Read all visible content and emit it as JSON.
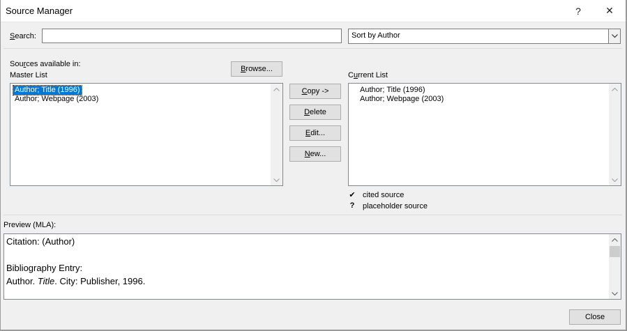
{
  "window": {
    "title": "Source Manager",
    "help_glyph": "?",
    "close_glyph": "✕"
  },
  "search": {
    "label_pre": "",
    "label_key": "S",
    "label_post": "earch:",
    "value": ""
  },
  "sort": {
    "selected": "Sort by Author"
  },
  "sources_available": {
    "label_pre": "Sou",
    "label_key": "r",
    "label_post": "ces available in:"
  },
  "master_list": {
    "label": "Master List",
    "items": [
      "Author; Title (1996)",
      "Author; Webpage (2003)"
    ],
    "selected_index": 0
  },
  "browse_button": {
    "key": "B",
    "rest": "rowse..."
  },
  "buttons": {
    "copy": {
      "key": "C",
      "rest": "opy ->"
    },
    "delete": {
      "key": "D",
      "rest": "elete"
    },
    "edit": {
      "key": "E",
      "rest": "dit..."
    },
    "new": {
      "key": "N",
      "rest": "ew..."
    }
  },
  "current_list": {
    "label_key": "u",
    "label_pre": "C",
    "label_post": "rrent List",
    "items": [
      "Author; Title (1996)",
      "Author; Webpage (2003)"
    ]
  },
  "legend": [
    {
      "symbol": "✔",
      "label": "cited source"
    },
    {
      "symbol": "?",
      "label": "placeholder source"
    }
  ],
  "preview": {
    "label": "Preview (MLA):",
    "citation": "Citation:  (Author)",
    "bibliography_heading": "Bibliography Entry:",
    "bib_author": "Author. ",
    "bib_title": "Title",
    "bib_rest": ". City: Publisher, 1996."
  },
  "close_button": {
    "label": "Close"
  }
}
